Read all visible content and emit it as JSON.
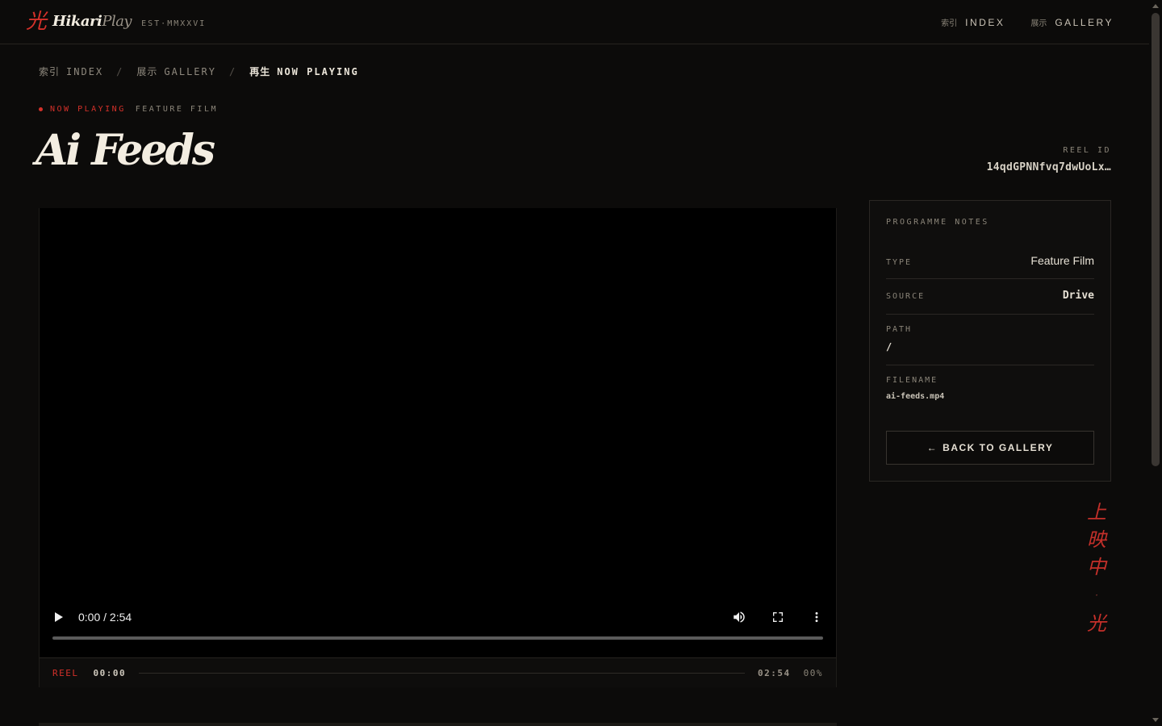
{
  "brand": {
    "logo_kanji": "光",
    "name_part1": "Hikari",
    "name_part2": "Play",
    "est": "EST·MMXXVI"
  },
  "nav": [
    {
      "jp": "索引",
      "en": "INDEX"
    },
    {
      "jp": "展示",
      "en": "GALLERY"
    }
  ],
  "breadcrumb": [
    {
      "jp": "索引",
      "en": "INDEX"
    },
    {
      "jp": "展示",
      "en": "GALLERY"
    },
    {
      "jp": "再生",
      "en": "NOW PLAYING"
    }
  ],
  "breadcrumb_sep": "/",
  "kicker": {
    "now_playing": "NOW PLAYING",
    "type": "FEATURE FILM"
  },
  "title": "Ai Feeds",
  "reel_id": {
    "label": "REEL ID",
    "value": "14qdGPNNfvq7dwUoLx…"
  },
  "player": {
    "time": "0:00 / 2:54",
    "progress": 0,
    "icons": [
      "play-icon",
      "volume-icon",
      "fullscreen-icon",
      "more-options-icon"
    ]
  },
  "reel_bar": {
    "label": "REEL",
    "current": "00:00",
    "duration": "02:54",
    "percent": "00%"
  },
  "notes": {
    "title": "PROGRAMME NOTES",
    "type_label": "TYPE",
    "type_value": "Feature Film",
    "source_label": "SOURCE",
    "source_value": "Drive",
    "path_label": "PATH",
    "path_value": "/",
    "filename_label": "FILENAME",
    "filename_value": "ai-feeds.mp4",
    "back_arrow": "←",
    "back_label": "BACK TO GALLERY"
  },
  "vertical_text": [
    "上",
    "映",
    "中",
    "·",
    "光"
  ],
  "colors": {
    "accent": "#d4312a",
    "background": "#0c0b0a",
    "text": "#e8e2d6",
    "muted": "#8a8478"
  }
}
